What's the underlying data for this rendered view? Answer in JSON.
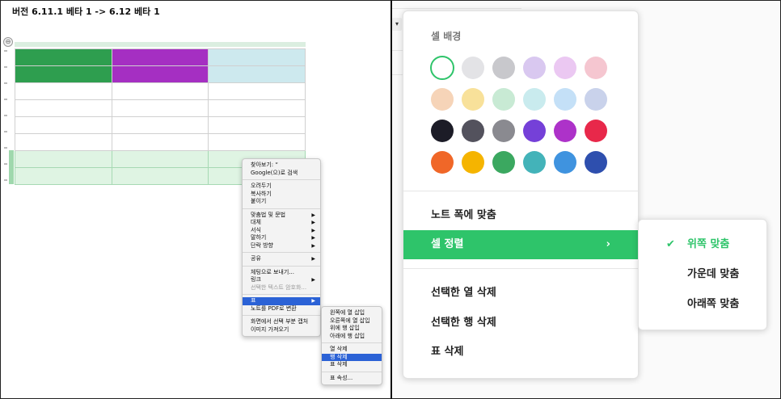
{
  "left": {
    "version": "버전 6.11.1 베타 1 -> 6.12 베타 1",
    "context_menu": {
      "groups": [
        [
          {
            "label": "찾아보기: “"
          },
          {
            "label": "Google(으)로 검색"
          }
        ],
        [
          {
            "label": "오려두기"
          },
          {
            "label": "복사하기"
          },
          {
            "label": "붙이기"
          }
        ],
        [
          {
            "label": "맞춤법 및 문법",
            "arrow": "▶"
          },
          {
            "label": "대체",
            "arrow": "▶"
          },
          {
            "label": "서식",
            "arrow": "▶"
          },
          {
            "label": "말하기",
            "arrow": "▶"
          },
          {
            "label": "단락 방향",
            "arrow": "▶"
          }
        ],
        [
          {
            "label": "공유",
            "arrow": "▶"
          }
        ],
        [
          {
            "label": "체팅으로 보내기..."
          },
          {
            "label": "링크",
            "arrow": "▶"
          },
          {
            "label": "선택한 텍스트 암호화...",
            "disabled": true
          }
        ],
        [
          {
            "label": "표",
            "arrow": "▶",
            "highlight": true
          },
          {
            "label": "노트를 PDF로 변환"
          }
        ],
        [
          {
            "label": "화면에서 선택 부분 캡처"
          },
          {
            "label": "이미지 가져오기"
          }
        ]
      ]
    },
    "table_submenu": {
      "groups": [
        [
          {
            "label": "왼쪽에 열 삽입"
          },
          {
            "label": "오른쪽에 열 삽입"
          },
          {
            "label": "위에 행 삽입"
          },
          {
            "label": "아래에 행 삽입"
          }
        ],
        [
          {
            "label": "열 삭제"
          },
          {
            "label": "행 삭제",
            "highlight": true
          },
          {
            "label": "표 삭제"
          }
        ],
        [
          {
            "label": "표 속성..."
          }
        ]
      ]
    }
  },
  "right": {
    "menu": {
      "title": "셀 배경",
      "swatches": [
        [
          "#ffffff",
          "#e3e3e6",
          "#c8c8cc",
          "#d9c8f0",
          "#ebc8f2",
          "#f5c6d0"
        ],
        [
          "#f6d4b8",
          "#f8e19a",
          "#c8ead4",
          "#c9ebee",
          "#c4e0f7",
          "#c9d2eb"
        ],
        [
          "#1c1c27",
          "#53525d",
          "#8a8a90",
          "#7540d8",
          "#ad32c9",
          "#e8284a"
        ],
        [
          "#f06728",
          "#f5b400",
          "#3ba860",
          "#43b3b9",
          "#3f93df",
          "#2e4fae"
        ]
      ],
      "selected_swatch": "#ffffff",
      "items": [
        {
          "label": "노트 폭에 맞춤"
        },
        {
          "label": "셀 정렬",
          "chevron": "›",
          "active": true
        },
        {
          "label": "선택한 열 삭제"
        },
        {
          "label": "선택한 행 삭제"
        },
        {
          "label": "표 삭제"
        }
      ],
      "accent": "#2ec46a"
    },
    "submenu": {
      "items": [
        {
          "label": "위쪽 맞춤",
          "checked": true,
          "check": "✔"
        },
        {
          "label": "가운데 맞춤"
        },
        {
          "label": "아래쪽 맞춤"
        }
      ]
    }
  }
}
